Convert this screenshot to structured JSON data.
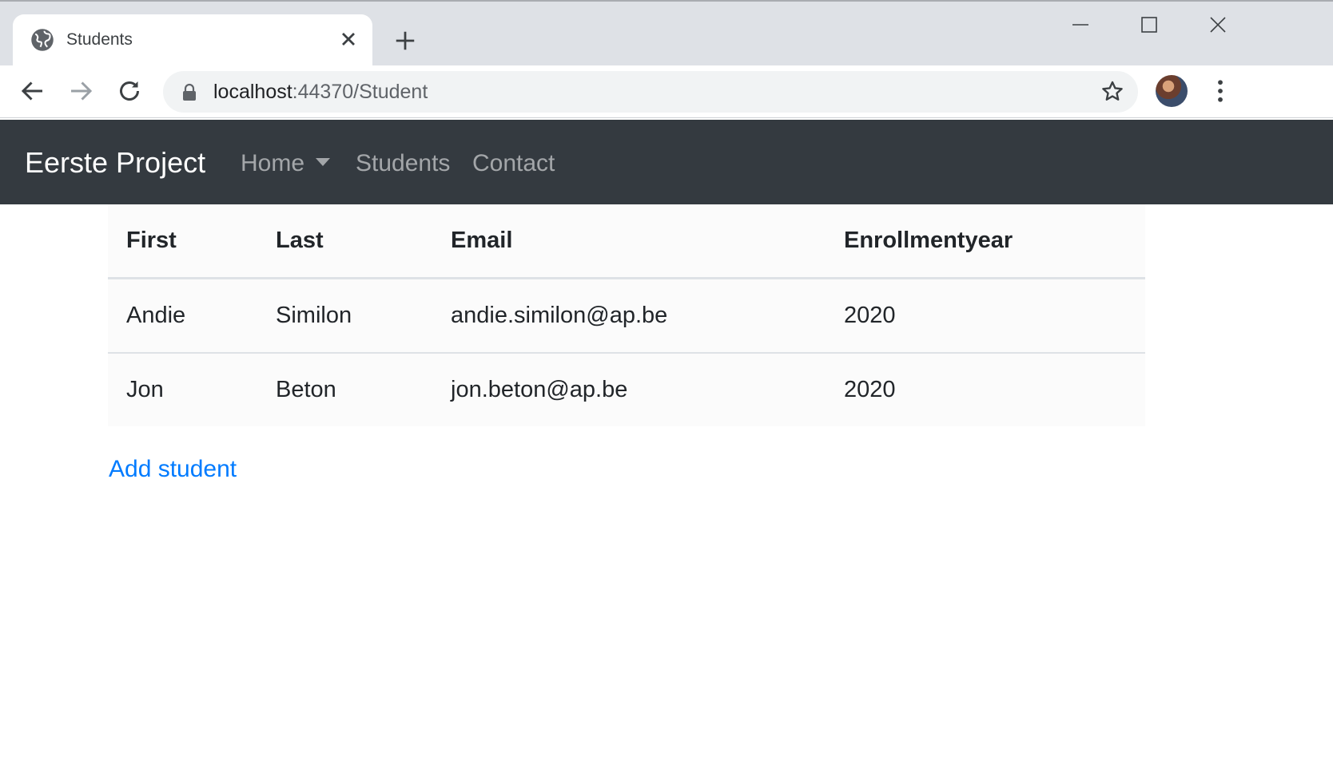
{
  "browser": {
    "tab": {
      "title": "Students"
    },
    "address": {
      "host": "localhost",
      "path": ":44370/Student"
    }
  },
  "navbar": {
    "brand": "Eerste Project",
    "links": [
      {
        "label": "Home",
        "dropdown": true
      },
      {
        "label": "Students"
      },
      {
        "label": "Contact"
      }
    ]
  },
  "table": {
    "headers": [
      "First",
      "Last",
      "Email",
      "Enrollmentyear"
    ],
    "rows": [
      [
        "Andie",
        "Similon",
        "andie.similon@ap.be",
        "2020"
      ],
      [
        "Jon",
        "Beton",
        "jon.beton@ap.be",
        "2020"
      ]
    ]
  },
  "actions": {
    "add_label": "Add student"
  },
  "colors": {
    "navbar": "#343a40",
    "link": "#007bff",
    "tabstrip": "#dee1e6"
  }
}
